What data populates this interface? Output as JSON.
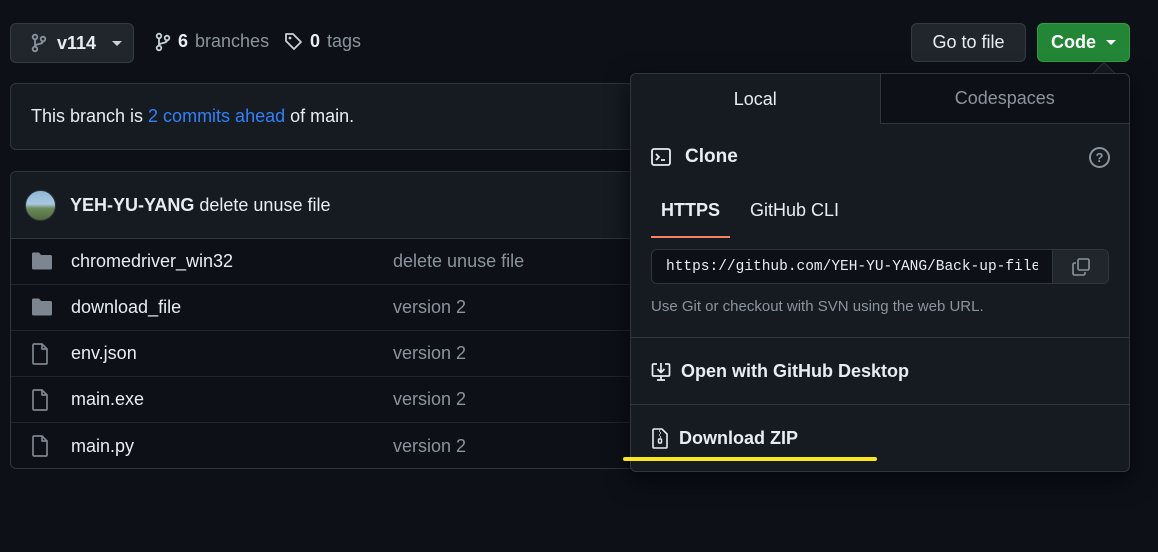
{
  "top_bar": {
    "branch": "v114",
    "branches_count": "6",
    "branches_label": "branches",
    "tags_count": "0",
    "tags_label": "tags",
    "go_to_file": "Go to file",
    "code": "Code"
  },
  "ahead": {
    "prefix": "This branch is",
    "link": "2 commits ahead",
    "suffix": "of main."
  },
  "commit": {
    "author": "YEH-YU-YANG",
    "message": "delete unuse file"
  },
  "files": [
    {
      "type": "folder",
      "name": "chromedriver_win32",
      "message": "delete unuse file"
    },
    {
      "type": "folder",
      "name": "download_file",
      "message": "version 2"
    },
    {
      "type": "file",
      "name": "env.json",
      "message": "version 2"
    },
    {
      "type": "file",
      "name": "main.exe",
      "message": "version 2"
    },
    {
      "type": "file",
      "name": "main.py",
      "message": "version 2"
    }
  ],
  "dropdown": {
    "tabs": [
      "Local",
      "Codespaces"
    ],
    "clone_title": "Clone",
    "protocols": [
      "HTTPS",
      "GitHub CLI"
    ],
    "url": "https://github.com/YEH-YU-YANG/Back-up-file-i",
    "url_note": "Use Git or checkout with SVN using the web URL.",
    "open_desktop": "Open with GitHub Desktop",
    "download_zip": "Download ZIP"
  },
  "colors": {
    "background": "#0d1117",
    "code_button": "#238636",
    "link": "#2f81f7",
    "tab_underline": "#f78166",
    "highlight": "#f8e71c"
  }
}
